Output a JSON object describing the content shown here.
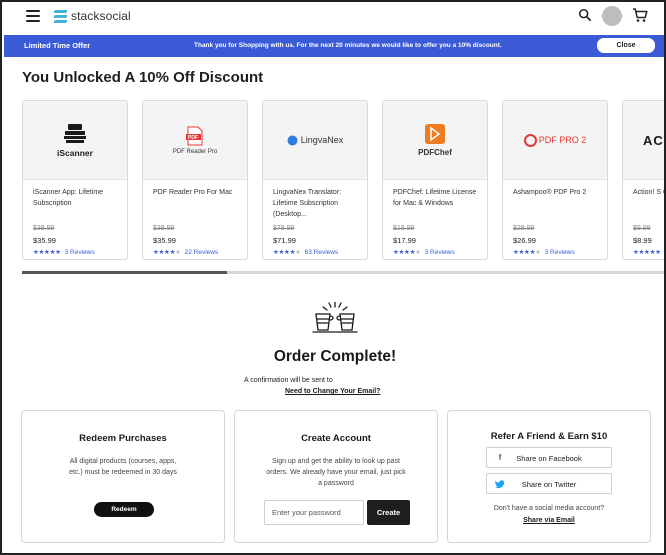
{
  "header": {
    "brand": "stacksocial",
    "icons": [
      "hamburger-menu-icon",
      "search-icon",
      "avatar",
      "cart-icon"
    ]
  },
  "promo": {
    "label": "Limited Time Offer",
    "message": "Thank you for Shopping with us. For the next 20 minutes we would like to offer you a 10% discount.",
    "close_label": "Close",
    "background": "#3b5ad6"
  },
  "discount_title": "You Unlocked A 10% Off Discount",
  "products": [
    {
      "logo_text": "iScanner",
      "name": "iScanner App: Lifetime Subscription",
      "old_price": "$39.99",
      "price": "$35.99",
      "stars": 5,
      "reviews": "3 Reviews"
    },
    {
      "logo_text": "PDF Reader Pro",
      "name": "PDF Reader Pro For Mac",
      "old_price": "$39.99",
      "price": "$35.99",
      "stars": 4,
      "reviews": "22 Reviews"
    },
    {
      "logo_text": "LingvaNex",
      "name": "LingvaNex Translator: Lifetime Subscription (Desktop...",
      "old_price": "$79.99",
      "price": "$71.99",
      "stars": 4,
      "reviews": "63 Reviews"
    },
    {
      "logo_text": "PDFChef",
      "name": "PDFChef: Lifetime License for Mac & Windows",
      "old_price": "$19.99",
      "price": "$17.99",
      "stars": 4,
      "reviews": "3 Reviews"
    },
    {
      "logo_text": "PDF PRO 2",
      "name": "Ashampoo® PDF Pro 2",
      "old_price": "$29.99",
      "price": "$26.99",
      "stars": 4,
      "reviews": "3 Reviews"
    },
    {
      "logo_text": "ACT",
      "name": "Action! S Gameplay Lifetime",
      "old_price": "$9.99",
      "price": "$8.99",
      "stars": 5,
      "reviews": ""
    }
  ],
  "scroll_progress": 0.32,
  "order": {
    "title": "Order Complete!",
    "confirmation": "A confirmation will be sent to",
    "change_email": "Need to Change Your Email?"
  },
  "redeem": {
    "title": "Redeem Purchases",
    "text": "All digital products (courses, apps, etc.) must be redeemed in 30 days",
    "button": "Redeem"
  },
  "account": {
    "title": "Create Account",
    "text": "Sign up and get the ability to look up past orders. We already have your email, just pick a password",
    "password_placeholder": "Enter your password",
    "button": "Create"
  },
  "refer": {
    "title": "Refer A Friend & Earn $10",
    "facebook": "Share on Facebook",
    "twitter": "Share on Twitter",
    "no_social": "Don't have a social media account?",
    "share_email": "Share via Email"
  }
}
